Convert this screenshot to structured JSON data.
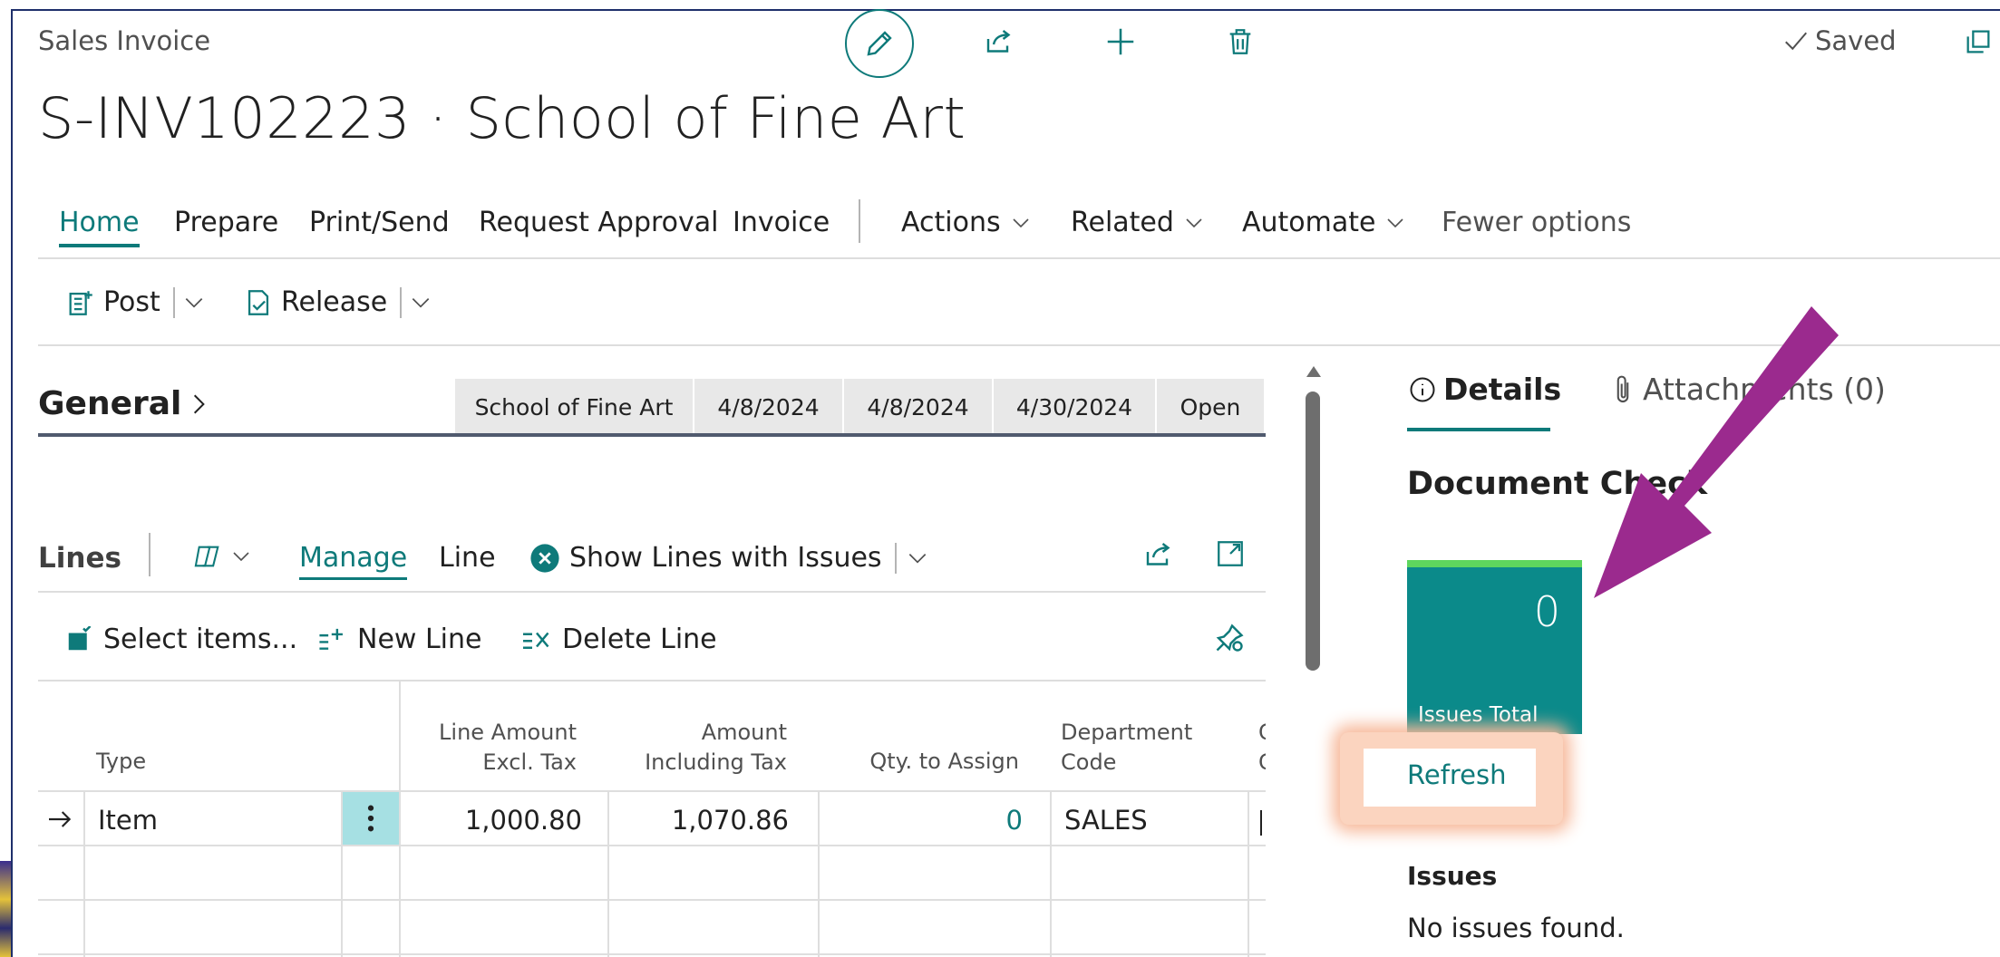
{
  "header": {
    "page_type": "Sales Invoice",
    "title": "S-INV102223 · School of Fine Art",
    "saved_label": "Saved"
  },
  "nav_tabs": [
    "Home",
    "Prepare",
    "Print/Send",
    "Request Approval",
    "Invoice",
    "Actions",
    "Related",
    "Automate",
    "Fewer options"
  ],
  "commands": {
    "post": "Post",
    "release": "Release"
  },
  "general": {
    "label": "General",
    "summary": [
      "School of Fine Art",
      "4/8/2024",
      "4/8/2024",
      "4/30/2024",
      "Open"
    ]
  },
  "lines": {
    "label": "Lines",
    "manage": "Manage",
    "line": "Line",
    "show_issues": "Show Lines with Issues",
    "select_items": "Select items...",
    "new_line": "New Line",
    "delete_line": "Delete Line",
    "columns": {
      "type": "Type",
      "line_amount_1": "Line Amount",
      "line_amount_2": "Excl. Tax",
      "amount_incl_1": "Amount",
      "amount_incl_2": "Including Tax",
      "qty_assign": "Qty. to Assign",
      "dept_1": "Department",
      "dept_2": "Code"
    },
    "rows": [
      {
        "type": "Item",
        "line_amount": "1,000.80",
        "amount_incl": "1,070.86",
        "qty_assign": "0",
        "dept": "SALES"
      }
    ]
  },
  "factbox": {
    "details_tab": "Details",
    "attachments_tab": "Attachments (0)",
    "heading": "Document Check",
    "tile_value": "0",
    "tile_label": "Issues Total",
    "refresh": "Refresh",
    "issues_heading": "Issues",
    "issues_text": "No issues found."
  },
  "colors": {
    "accent": "#0e7a7a",
    "tile": "#0b8a8a",
    "tile_bar": "#5ed65e",
    "arrow": "#9b2a8e",
    "highlight": "#f7b899"
  }
}
